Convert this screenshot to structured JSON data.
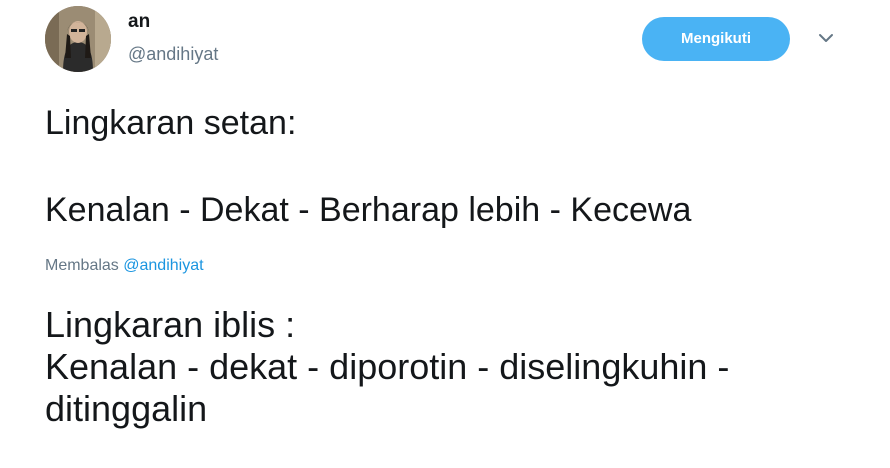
{
  "user": {
    "display_name": "an",
    "handle": "@andihiyat",
    "avatar": "profile-photo"
  },
  "follow_button": {
    "label": "Mengikuti",
    "color": "#4ab3f4"
  },
  "menu_caret": {
    "icon": "chevron-down-icon"
  },
  "tweet": {
    "lines": [
      "Lingkaran setan:",
      "Kenalan - Dekat - Berharap lebih - Kecewa"
    ]
  },
  "reply_context": {
    "prefix": "Membalas",
    "mention": "@andihiyat",
    "mention_color": "#1b95e0"
  },
  "reply": {
    "lines": [
      "Lingkaran iblis :",
      "Kenalan - dekat - diporotin - diselingkuhin -",
      "ditinggalin"
    ]
  }
}
